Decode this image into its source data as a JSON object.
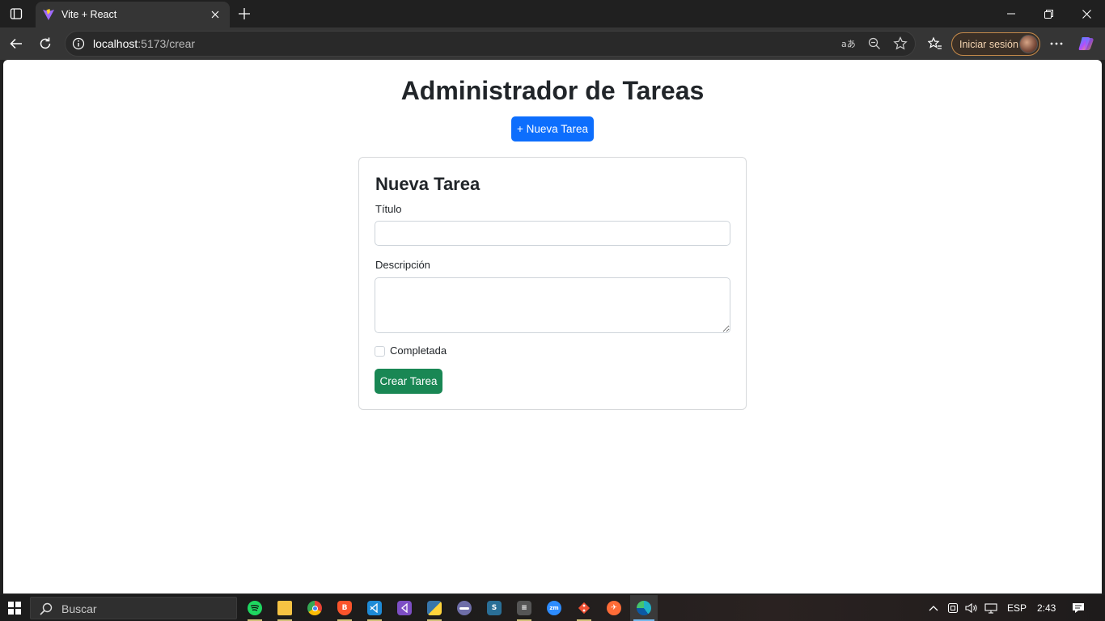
{
  "browser": {
    "tab_title": "Vite + React",
    "url_host": "localhost",
    "url_path": ":5173/crear",
    "signin_label": "Iniciar sesión"
  },
  "page": {
    "app_title": "Administrador de Tareas",
    "new_task_button": "+ Nueva Tarea",
    "form": {
      "title": "Nueva Tarea",
      "titulo_label": "Título",
      "titulo_value": "",
      "descripcion_label": "Descripción",
      "descripcion_value": "",
      "completed_label": "Completada",
      "completed_checked": false,
      "submit_label": "Crear Tarea"
    }
  },
  "colors": {
    "primary": "#0d6efd",
    "success": "#198754",
    "text": "#212529"
  },
  "taskbar": {
    "search_placeholder": "Buscar",
    "apps": [
      "spotify-icon",
      "file-explorer-icon",
      "chrome-icon",
      "brave-icon",
      "vscode-icon",
      "visual-studio-icon",
      "python-icon",
      "app-icon",
      "sql-server-icon",
      "tool-icon",
      "zoom-icon",
      "git-icon",
      "postman-icon",
      "edge-icon"
    ],
    "language": "ESP",
    "time": "2:43"
  }
}
